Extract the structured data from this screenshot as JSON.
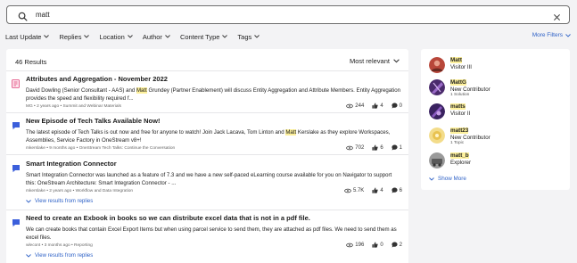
{
  "search": {
    "value": "matt",
    "placeholder": ""
  },
  "filters": [
    "Last Update",
    "Replies",
    "Location",
    "Author",
    "Content Type",
    "Tags"
  ],
  "more_filters": "More Filters",
  "results_count": "46 Results",
  "sort": "Most relevant",
  "results": [
    {
      "title": "Attributes and Aggregation - November 2022",
      "body_pre": "David Dowling (Senior Consultant - AAS) and ",
      "body_hl": "Matt",
      "body_post": " Grundey (Partner Enablement) will discuss Entity Aggregation and Attribute Members. Entity Aggregation provides the speed and flexibility required f...",
      "meta": "MG • 2 years ago • Summit and Webinar Materials",
      "views": "244",
      "likes": "4",
      "replies": "0",
      "view_replies": ""
    },
    {
      "title": "New Episode of Tech Talks Available Now!",
      "body_pre": "The latest episode of Tech Talks is out now and free for anyone to watch! Join Jack Lacava, Tom Linton and ",
      "body_hl": "Matt",
      "body_post": " Kerslake as they explore Workspaces, Assemblies, Service Factory in OneStream v8+!",
      "meta": "mkerslake • 9 months ago • OneStream Tech Talks: Continue the Conversation",
      "views": "702",
      "likes": "6",
      "replies": "1",
      "view_replies": ""
    },
    {
      "title": "Smart Integration Connector",
      "body_pre": "Smart Integration Connector was launched as a feature of 7.3 and we have a new self-paced eLearning course available for you on Navigator to support this: OneStream Architecture: Smart Integration Connector - ...",
      "body_hl": "",
      "body_post": "",
      "meta": "mkerslake • 2 years ago • Workflow and Data Integration",
      "views": "5.7K",
      "likes": "4",
      "replies": "6",
      "view_replies": "View results from replies"
    },
    {
      "title": "Need to create an Exbook in books so we can distribute excel data that is not in a pdf file.",
      "body_pre": "We can create books that contain Excel Export Items but when using parcel service to send them, they are attached as pdf files. We need to send them as excel files.",
      "body_hl": "",
      "body_post": "",
      "meta": "wlecont • 3 months ago • Reporting",
      "views": "196",
      "likes": "0",
      "replies": "2",
      "view_replies": "View results from replies"
    }
  ],
  "users": [
    {
      "name": "Matt",
      "rank": "Visitor III",
      "sub": "",
      "color": "#b8473a"
    },
    {
      "name": "MattG",
      "rank": "New Contributor",
      "sub": "1 Solution",
      "color": "#6b3a8c"
    },
    {
      "name": "matts",
      "rank": "Visitor II",
      "sub": "",
      "color": "#5a3a8c"
    },
    {
      "name": "matt23",
      "rank": "New Contributor",
      "sub": "1 Topic",
      "color": "#e8c250"
    },
    {
      "name": "matt_b",
      "rank": "Explorer",
      "sub": "",
      "color": "#8a8a8a"
    }
  ],
  "show_more": "Show More",
  "colors": {
    "accent": "#2f62c7",
    "highlight": "#fdf09b",
    "icon_blue": "#3b5fdb",
    "icon_pink": "#e0457b"
  },
  "icons": {
    "search": "search-icon",
    "clear": "close-icon",
    "doc": "document-icon",
    "chat": "chat-bubble-icon",
    "views": "eye-icon",
    "likes": "thumbs-up-icon",
    "replies": "comment-icon"
  }
}
